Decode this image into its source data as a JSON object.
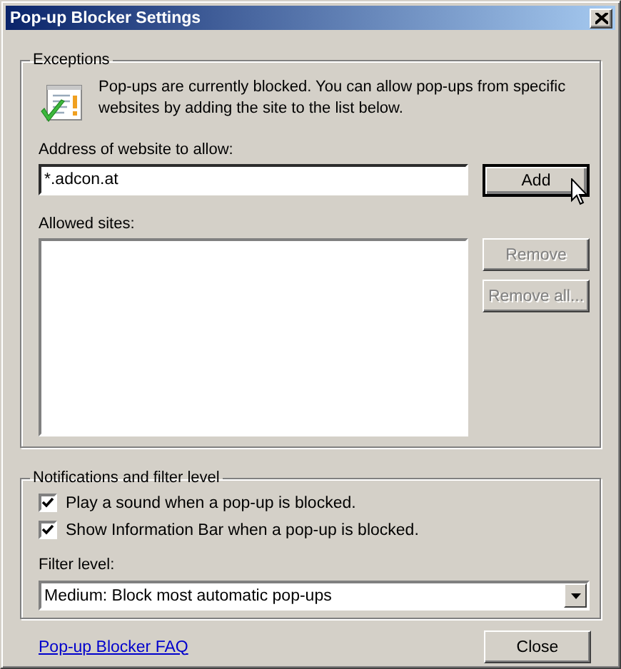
{
  "window": {
    "title": "Pop-up Blocker Settings"
  },
  "exceptions": {
    "legend": "Exceptions",
    "description": "Pop-ups are currently blocked.  You can allow pop-ups from specific websites by adding the site to the list below.",
    "address_label": "Address of website to allow:",
    "address_value": "*.adcon.at",
    "add_button": {
      "label": "Add",
      "default": true,
      "disabled": false
    },
    "allowed_label": "Allowed sites:",
    "buttons": [
      {
        "label": "Remove",
        "disabled": true
      },
      {
        "label": "Remove all...",
        "disabled": true
      }
    ]
  },
  "notifications": {
    "legend": "Notifications and filter level",
    "options": [
      {
        "label": "Play a sound when a pop-up is blocked.",
        "checked": true
      },
      {
        "label": "Show Information Bar when a pop-up is blocked.",
        "checked": true
      }
    ],
    "filter_label": "Filter level:",
    "filter_value": "Medium: Block most automatic pop-ups"
  },
  "footer": {
    "link": "Pop-up Blocker FAQ",
    "close_button": "Close"
  }
}
